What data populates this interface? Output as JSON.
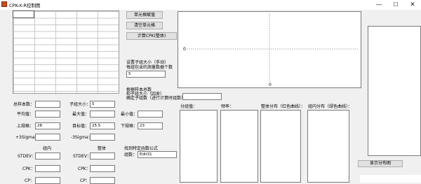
{
  "window": {
    "title": "CPK-X-R控制图",
    "minimize_glyph": "—",
    "maximize_glyph": "☐",
    "close_glyph": "✕"
  },
  "buttons": {
    "cell_value": "单元格赋值",
    "clear_cell": "清空单元格",
    "calc_cpk": "计算CPK(整体)",
    "show_distribution": "显示分布图"
  },
  "subgroup_setup": {
    "label_line1": "设置子组大小（手动）",
    "label_line2": "每组包含的测量数据个数",
    "value": "5"
  },
  "group_setup": {
    "label_line1": "根据样本总数",
    "label_line2": "和子组大小（四舍）",
    "label_line3": "确定子组数（进行计算时组数）",
    "value": ""
  },
  "chart": {
    "y_tick": "0",
    "x_tick": "0"
  },
  "stats": {
    "total_samples": {
      "label": "总样本数：",
      "value": ""
    },
    "subgroup_size": {
      "label": "子组大小：",
      "value": "5"
    },
    "mean": {
      "label": "平均值：",
      "value": ""
    },
    "max": {
      "label": "最大值：",
      "value": ""
    },
    "min": {
      "label": "最小值：",
      "value": ""
    },
    "usl": {
      "label": "上规格：",
      "value": "28"
    },
    "target": {
      "label": "目标值：",
      "value": "25.5"
    },
    "lsl": {
      "label": "下规格：",
      "value": "23"
    },
    "plus3sigma": {
      "label": "+3Sigma：",
      "value": ""
    },
    "minus3sigma": {
      "label": "-3Sigma：",
      "value": ""
    }
  },
  "columns": {
    "within": "组内",
    "overall": "整体"
  },
  "within_group": {
    "stdev": {
      "label": "STDEV：",
      "value": ""
    },
    "cpk": {
      "label": "CPK：",
      "value": ""
    },
    "cp": {
      "label": "CP：",
      "value": ""
    }
  },
  "overall_group": {
    "stdev": {
      "label": "STDEV：",
      "value": ""
    },
    "cpk": {
      "label": "CPK：",
      "value": ""
    },
    "cp": {
      "label": "CP：",
      "value": ""
    }
  },
  "formula": {
    "title": "找到特定函数公式",
    "groups_label": "组数：",
    "groups_value": "Edit31"
  },
  "distribution": {
    "group_value_label": "分组值：",
    "frequency_label": "频率：",
    "overall_label": "整体分布（红色曲线）：",
    "within_label": "组内分布（绿色曲线）："
  }
}
